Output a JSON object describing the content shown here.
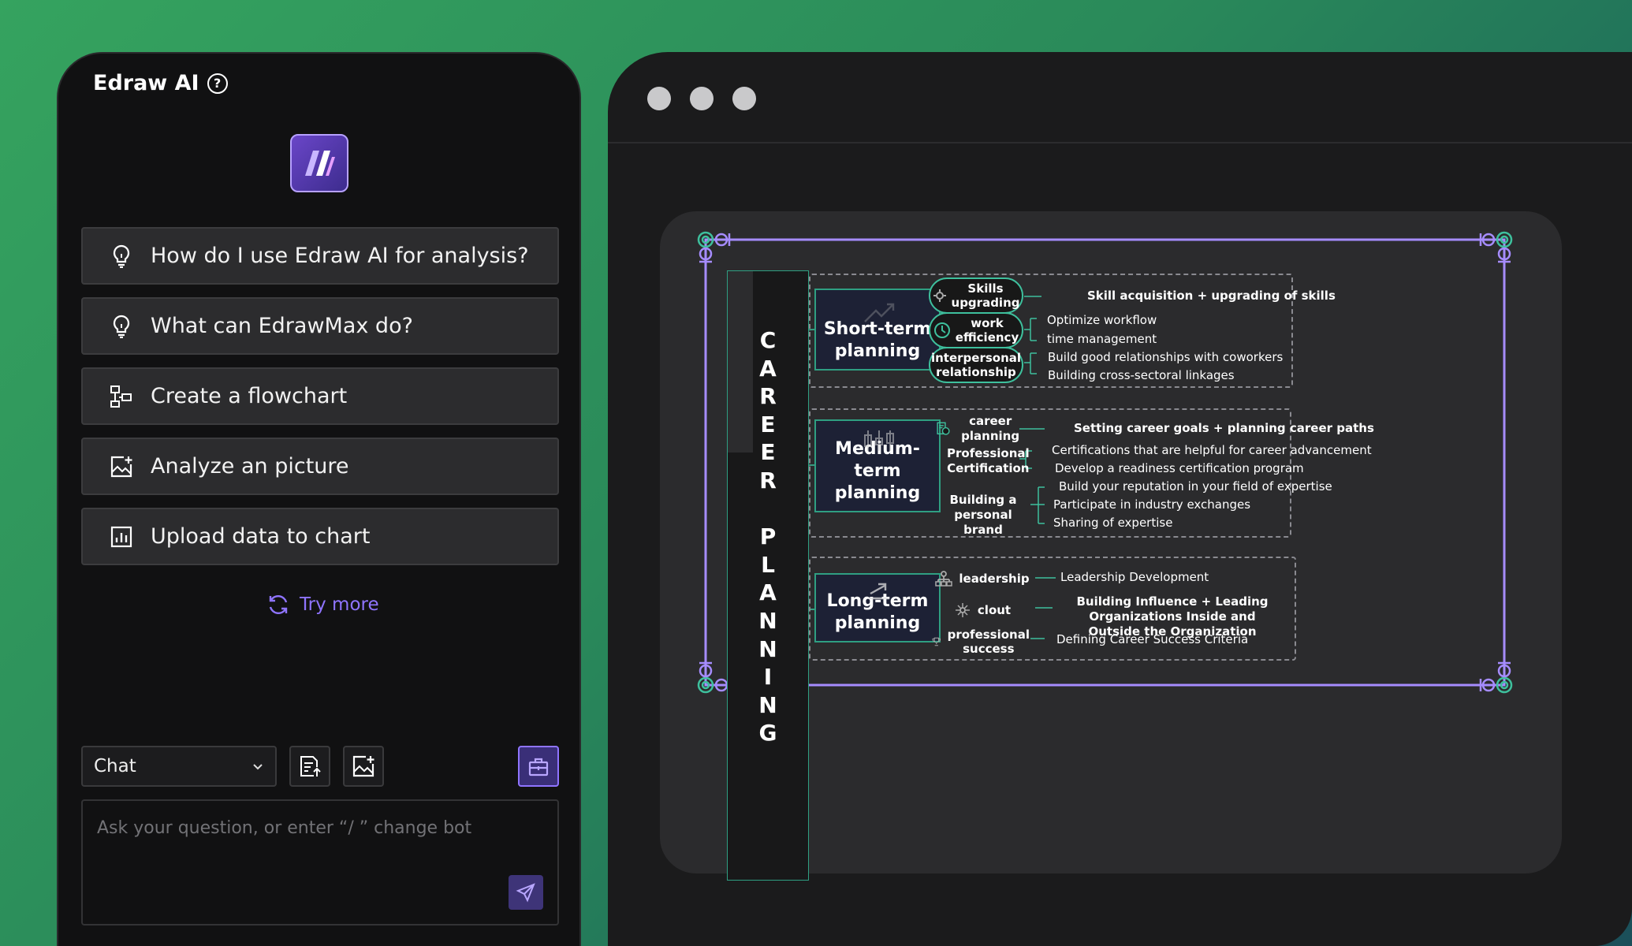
{
  "left_panel": {
    "title": "Edraw AI",
    "help_icon": "?",
    "suggestions": [
      {
        "label": "How do I use Edraw AI for analysis?",
        "icon": "lightbulb-icon"
      },
      {
        "label": "What can EdrawMax do?",
        "icon": "lightbulb-icon"
      },
      {
        "label": "Create a flowchart",
        "icon": "flowchart-icon"
      },
      {
        "label": "Analyze an picture",
        "icon": "image-add-icon"
      },
      {
        "label": "Upload data to chart",
        "icon": "chart-icon"
      }
    ],
    "try_more": "Try more",
    "chat_mode": "Chat",
    "input_placeholder": "Ask your question, or enter  “/ ” change bot"
  },
  "diagram": {
    "root": "CAREER PLANNING",
    "root_letters": [
      "C",
      "A",
      "R",
      "E",
      "E",
      "R",
      "",
      "P",
      "L",
      "A",
      "N",
      "N",
      "I",
      "N",
      "G"
    ],
    "groups": [
      {
        "title_lines": [
          "Short-term",
          "planning"
        ],
        "subs": [
          {
            "label_lines": [
              "Skills",
              "upgrading"
            ],
            "leaves": [
              "Skill acquisition + upgrading of skills"
            ]
          },
          {
            "label_lines": [
              "work",
              "efficiency"
            ],
            "leaves": [
              "Optimize workflow",
              "time management"
            ]
          },
          {
            "label_lines": [
              "interpersonal",
              "relationship"
            ],
            "leaves": [
              "Build good relationships with coworkers",
              "Building cross-sectoral linkages"
            ]
          }
        ]
      },
      {
        "title_lines": [
          "Medium-",
          "term",
          "planning"
        ],
        "subs": [
          {
            "label_lines": [
              "career planning"
            ],
            "leaves": [
              "Setting career goals + planning career paths"
            ]
          },
          {
            "label_lines": [
              "Professional",
              "Certification"
            ],
            "leaves": [
              "Certifications that are helpful for career advancement",
              "Develop a readiness certification program"
            ]
          },
          {
            "label_lines": [
              "Building a personal",
              "brand"
            ],
            "leaves": [
              "Build your reputation in your field of expertise",
              "Participate in industry exchanges",
              "Sharing of expertise"
            ]
          }
        ]
      },
      {
        "title_lines": [
          "Long-term",
          "planning"
        ],
        "subs": [
          {
            "label_lines": [
              "leadership"
            ],
            "leaves": [
              "Leadership Development"
            ]
          },
          {
            "label_lines": [
              "clout"
            ],
            "leaves": [
              "Building Influence + Leading Organizations Inside and",
              "Outside the Organization"
            ]
          },
          {
            "label_lines": [
              "professional",
              "success"
            ],
            "leaves": [
              "Defining Career Success Criteria"
            ]
          }
        ]
      }
    ]
  },
  "colors": {
    "accent_purple": "#8f74ff",
    "node_green": "#3ec09d",
    "selection_purple": "#a68cff"
  }
}
